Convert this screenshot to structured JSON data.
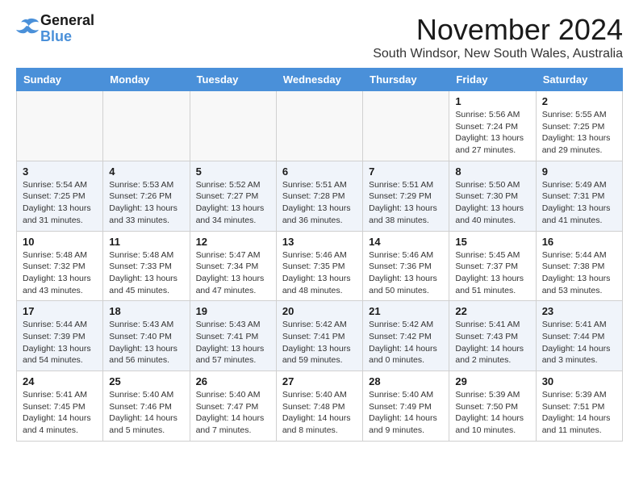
{
  "header": {
    "logo_line1": "General",
    "logo_line2": "Blue",
    "month": "November 2024",
    "location": "South Windsor, New South Wales, Australia"
  },
  "weekdays": [
    "Sunday",
    "Monday",
    "Tuesday",
    "Wednesday",
    "Thursday",
    "Friday",
    "Saturday"
  ],
  "weeks": [
    [
      {
        "day": "",
        "info": ""
      },
      {
        "day": "",
        "info": ""
      },
      {
        "day": "",
        "info": ""
      },
      {
        "day": "",
        "info": ""
      },
      {
        "day": "",
        "info": ""
      },
      {
        "day": "1",
        "info": "Sunrise: 5:56 AM\nSunset: 7:24 PM\nDaylight: 13 hours\nand 27 minutes."
      },
      {
        "day": "2",
        "info": "Sunrise: 5:55 AM\nSunset: 7:25 PM\nDaylight: 13 hours\nand 29 minutes."
      }
    ],
    [
      {
        "day": "3",
        "info": "Sunrise: 5:54 AM\nSunset: 7:25 PM\nDaylight: 13 hours\nand 31 minutes."
      },
      {
        "day": "4",
        "info": "Sunrise: 5:53 AM\nSunset: 7:26 PM\nDaylight: 13 hours\nand 33 minutes."
      },
      {
        "day": "5",
        "info": "Sunrise: 5:52 AM\nSunset: 7:27 PM\nDaylight: 13 hours\nand 34 minutes."
      },
      {
        "day": "6",
        "info": "Sunrise: 5:51 AM\nSunset: 7:28 PM\nDaylight: 13 hours\nand 36 minutes."
      },
      {
        "day": "7",
        "info": "Sunrise: 5:51 AM\nSunset: 7:29 PM\nDaylight: 13 hours\nand 38 minutes."
      },
      {
        "day": "8",
        "info": "Sunrise: 5:50 AM\nSunset: 7:30 PM\nDaylight: 13 hours\nand 40 minutes."
      },
      {
        "day": "9",
        "info": "Sunrise: 5:49 AM\nSunset: 7:31 PM\nDaylight: 13 hours\nand 41 minutes."
      }
    ],
    [
      {
        "day": "10",
        "info": "Sunrise: 5:48 AM\nSunset: 7:32 PM\nDaylight: 13 hours\nand 43 minutes."
      },
      {
        "day": "11",
        "info": "Sunrise: 5:48 AM\nSunset: 7:33 PM\nDaylight: 13 hours\nand 45 minutes."
      },
      {
        "day": "12",
        "info": "Sunrise: 5:47 AM\nSunset: 7:34 PM\nDaylight: 13 hours\nand 47 minutes."
      },
      {
        "day": "13",
        "info": "Sunrise: 5:46 AM\nSunset: 7:35 PM\nDaylight: 13 hours\nand 48 minutes."
      },
      {
        "day": "14",
        "info": "Sunrise: 5:46 AM\nSunset: 7:36 PM\nDaylight: 13 hours\nand 50 minutes."
      },
      {
        "day": "15",
        "info": "Sunrise: 5:45 AM\nSunset: 7:37 PM\nDaylight: 13 hours\nand 51 minutes."
      },
      {
        "day": "16",
        "info": "Sunrise: 5:44 AM\nSunset: 7:38 PM\nDaylight: 13 hours\nand 53 minutes."
      }
    ],
    [
      {
        "day": "17",
        "info": "Sunrise: 5:44 AM\nSunset: 7:39 PM\nDaylight: 13 hours\nand 54 minutes."
      },
      {
        "day": "18",
        "info": "Sunrise: 5:43 AM\nSunset: 7:40 PM\nDaylight: 13 hours\nand 56 minutes."
      },
      {
        "day": "19",
        "info": "Sunrise: 5:43 AM\nSunset: 7:41 PM\nDaylight: 13 hours\nand 57 minutes."
      },
      {
        "day": "20",
        "info": "Sunrise: 5:42 AM\nSunset: 7:41 PM\nDaylight: 13 hours\nand 59 minutes."
      },
      {
        "day": "21",
        "info": "Sunrise: 5:42 AM\nSunset: 7:42 PM\nDaylight: 14 hours\nand 0 minutes."
      },
      {
        "day": "22",
        "info": "Sunrise: 5:41 AM\nSunset: 7:43 PM\nDaylight: 14 hours\nand 2 minutes."
      },
      {
        "day": "23",
        "info": "Sunrise: 5:41 AM\nSunset: 7:44 PM\nDaylight: 14 hours\nand 3 minutes."
      }
    ],
    [
      {
        "day": "24",
        "info": "Sunrise: 5:41 AM\nSunset: 7:45 PM\nDaylight: 14 hours\nand 4 minutes."
      },
      {
        "day": "25",
        "info": "Sunrise: 5:40 AM\nSunset: 7:46 PM\nDaylight: 14 hours\nand 5 minutes."
      },
      {
        "day": "26",
        "info": "Sunrise: 5:40 AM\nSunset: 7:47 PM\nDaylight: 14 hours\nand 7 minutes."
      },
      {
        "day": "27",
        "info": "Sunrise: 5:40 AM\nSunset: 7:48 PM\nDaylight: 14 hours\nand 8 minutes."
      },
      {
        "day": "28",
        "info": "Sunrise: 5:40 AM\nSunset: 7:49 PM\nDaylight: 14 hours\nand 9 minutes."
      },
      {
        "day": "29",
        "info": "Sunrise: 5:39 AM\nSunset: 7:50 PM\nDaylight: 14 hours\nand 10 minutes."
      },
      {
        "day": "30",
        "info": "Sunrise: 5:39 AM\nSunset: 7:51 PM\nDaylight: 14 hours\nand 11 minutes."
      }
    ]
  ]
}
